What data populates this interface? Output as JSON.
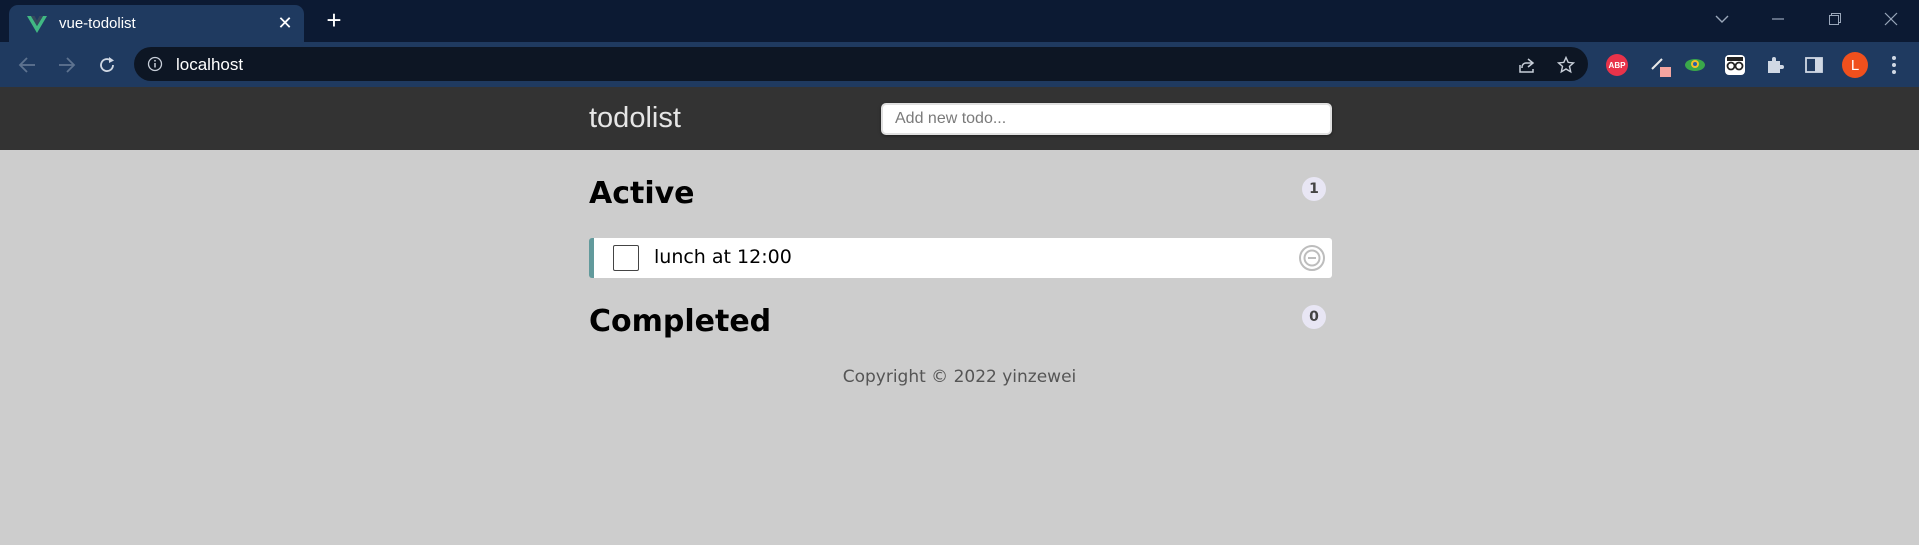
{
  "browser": {
    "tab_title": "vue-todolist",
    "url": "localhost",
    "avatar_initial": "L",
    "abp_label": "ABP"
  },
  "app": {
    "brand": "todolist",
    "input_placeholder": "Add new todo...",
    "sections": {
      "active": {
        "title": "Active",
        "count": "1"
      },
      "completed": {
        "title": "Completed",
        "count": "0"
      }
    },
    "todos": [
      {
        "text": "lunch at 12:00",
        "done": false
      }
    ],
    "footer": "Copyright © 2022 yinzewei"
  },
  "colors": {
    "tabstrip": "#0c1a33",
    "toolbar": "#1f3a60",
    "header": "#333333",
    "page": "#cdcdcd",
    "accent": "#629a9c"
  }
}
